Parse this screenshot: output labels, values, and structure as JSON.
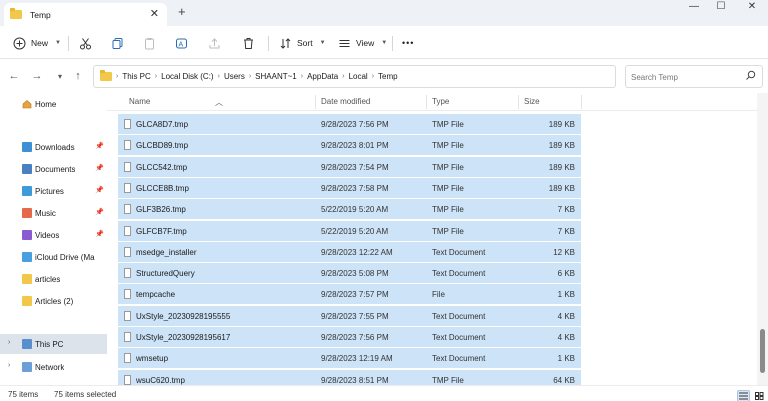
{
  "window": {
    "tab_title": "Temp",
    "new_tab": "+",
    "close_tab": "✕",
    "minimize": "—",
    "maximize": "☐",
    "close": "✕",
    "folder_color": "#f2c84b"
  },
  "toolbar": {
    "new_label": "New",
    "sort_label": "Sort",
    "view_label": "View",
    "more_label": "•••"
  },
  "address": {
    "breadcrumbs": [
      "This PC",
      "Local Disk (C:)",
      "Users",
      "SHAANT~1",
      "AppData",
      "Local",
      "Temp"
    ],
    "search_placeholder": "Search Temp"
  },
  "nav": {
    "home": "Home",
    "downloads": "Downloads",
    "documents": "Documents",
    "pictures": "Pictures",
    "music": "Music",
    "videos": "Videos",
    "icloud": "iCloud Drive (Ma",
    "articles": "articles",
    "articles2": "Articles (2)",
    "this_pc": "This PC",
    "network": "Network"
  },
  "columns": {
    "name": "Name",
    "date": "Date modified",
    "type": "Type",
    "size": "Size"
  },
  "files": [
    {
      "name": "GLCA8D7.tmp",
      "date": "9/28/2023 7:56 PM",
      "type": "TMP File",
      "size": "189 KB"
    },
    {
      "name": "GLCBD89.tmp",
      "date": "9/28/2023 8:01 PM",
      "type": "TMP File",
      "size": "189 KB"
    },
    {
      "name": "GLCC542.tmp",
      "date": "9/28/2023 7:54 PM",
      "type": "TMP File",
      "size": "189 KB"
    },
    {
      "name": "GLCCE8B.tmp",
      "date": "9/28/2023 7:58 PM",
      "type": "TMP File",
      "size": "189 KB"
    },
    {
      "name": "GLF3B26.tmp",
      "date": "5/22/2019 5:20 AM",
      "type": "TMP File",
      "size": "7 KB"
    },
    {
      "name": "GLFCB7F.tmp",
      "date": "5/22/2019 5:20 AM",
      "type": "TMP File",
      "size": "7 KB"
    },
    {
      "name": "msedge_installer",
      "date": "9/28/2023 12:22 AM",
      "type": "Text Document",
      "size": "12 KB"
    },
    {
      "name": "StructuredQuery",
      "date": "9/28/2023 5:08 PM",
      "type": "Text Document",
      "size": "6 KB"
    },
    {
      "name": "tempcache",
      "date": "9/28/2023 7:57 PM",
      "type": "File",
      "size": "1 KB"
    },
    {
      "name": "UxStyle_20230928195555",
      "date": "9/28/2023 7:55 PM",
      "type": "Text Document",
      "size": "4 KB"
    },
    {
      "name": "UxStyle_20230928195617",
      "date": "9/28/2023 7:56 PM",
      "type": "Text Document",
      "size": "4 KB"
    },
    {
      "name": "wmsetup",
      "date": "9/28/2023 12:19 AM",
      "type": "Text Document",
      "size": "1 KB"
    },
    {
      "name": "wsuC620.tmp",
      "date": "9/28/2023 8:51 PM",
      "type": "TMP File",
      "size": "64 KB"
    }
  ],
  "status": {
    "item_count": "75 items",
    "selected_count": "75 items selected"
  },
  "colors": {
    "selection": "#cde3f7",
    "nav_selected": "#dde3ea",
    "titlebar": "#eef1f6"
  }
}
